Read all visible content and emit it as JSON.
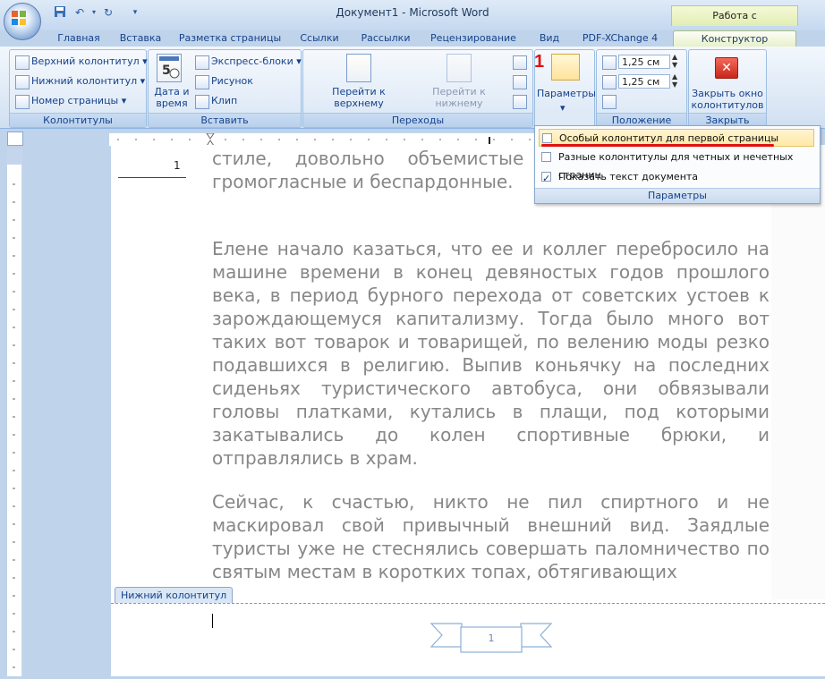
{
  "window": {
    "title": "Документ1 - Microsoft Word",
    "context_tab_title": "Работа с колонтитулами"
  },
  "quick_access": {
    "save_icon": "save-icon",
    "undo_icon": "undo-icon",
    "redo_icon": "redo-icon",
    "customize_icon": "chevron-down-icon"
  },
  "tabs": [
    {
      "label": "Главная"
    },
    {
      "label": "Вставка"
    },
    {
      "label": "Разметка страницы"
    },
    {
      "label": "Ссылки"
    },
    {
      "label": "Рассылки"
    },
    {
      "label": "Рецензирование"
    },
    {
      "label": "Вид"
    },
    {
      "label": "PDF-XChange 4"
    },
    {
      "label": "Конструктор"
    }
  ],
  "ribbon": {
    "kolontituly": {
      "label": "Колонтитулы",
      "header": "Верхний колонтитул",
      "footer": "Нижний колонтитул",
      "page_number": "Номер страницы"
    },
    "insert": {
      "label": "Вставить",
      "date_time": "Дата и время",
      "express_blocks": "Экспресс-блоки",
      "picture": "Рисунок",
      "clip": "Клип"
    },
    "navigation": {
      "label": "Переходы",
      "goto_header": "Перейти к верхнему колонтитулу",
      "goto_footer": "Перейти к нижнему колонтитулу"
    },
    "params": {
      "label": "Параметры",
      "callout": "1"
    },
    "position": {
      "label": "Положение",
      "header_from_top": "1,25 см",
      "footer_from_bottom": "1,25 см"
    },
    "close": {
      "label": "Закрыть",
      "button": "Закрыть окно колонтитулов"
    }
  },
  "dropdown": {
    "items": [
      {
        "label": "Особый колонтитул для первой страницы",
        "checked": false
      },
      {
        "label": "Разные колонтитулы для четных и нечетных страниц",
        "checked": false
      },
      {
        "label": "Показать текст документа",
        "checked": true
      }
    ],
    "footer": "Параметры"
  },
  "document": {
    "header_page_number": "1",
    "paragraphs": [
      "стиле, довольно объемистые — излишним весом, громогласные и беспардонные.",
      "Елене начало казаться, что ее и коллег перебросило на машине времени в конец девяностых годов прошлого века, в период бурного перехода от советских устоев к зарождающемуся капитализму. Тогда было много вот таких вот товарок и товарищей, по велению моды резко подавшихся в религию. Выпив коньячку на последних сиденьях туристического автобуса, они обвязывали головы платками, кутались в плащи, под которыми закатывались до колен спортивные брюки, и отправлялись в храм.",
      "Сейчас, к счастью, никто не пил спиртного и не маскировал свой привычный внешний вид. Заядлые туристы уже не стеснялись совершать паломничество по святым местам в коротких топах, обтягивающих"
    ],
    "footer_tab": "Нижний колонтитул",
    "footer_page_number": "1"
  },
  "colors": {
    "accent_red": "#e01010",
    "ribbon_blue": "#15428b",
    "context_green": "#e2edb3"
  }
}
